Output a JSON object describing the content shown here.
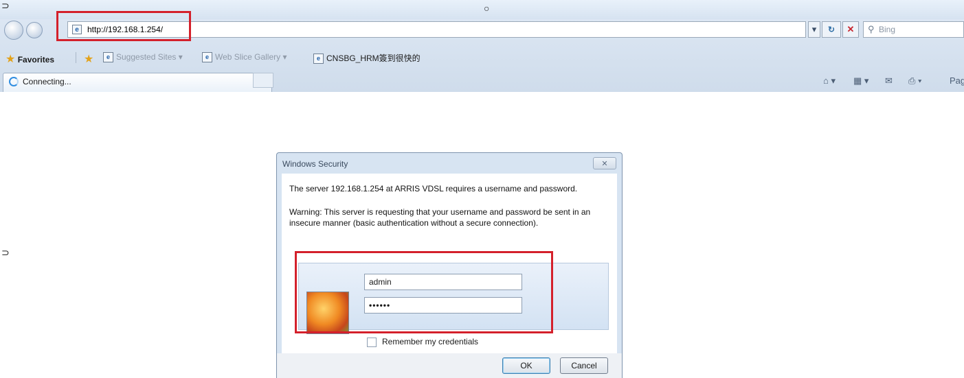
{
  "browser": {
    "address_url": "http://192.168.1.254/",
    "search_placeholder": "Bing",
    "favorites": {
      "label": "Favorites",
      "items": [
        "Suggested Sites ▾",
        "Web Slice Gallery ▾",
        "CNSBG_HRM簽到很快的"
      ]
    },
    "tab": {
      "label": "Connecting..."
    },
    "command_bar": "Pag"
  },
  "dialog": {
    "title": "Windows Security",
    "close_label": "✕",
    "message": "The server 192.168.1.254 at ARRIS VDSL requires a username and password.",
    "warning": "Warning: This server is requesting that your username and password be sent in an insecure manner (basic authentication without a secure connection).",
    "username": "admin",
    "password": "••••••",
    "remember_label": "Remember my credentials",
    "ok_label": "OK",
    "cancel_label": "Cancel"
  },
  "colors": {
    "highlight": "#d4202b",
    "chrome": "#d6e3f1"
  }
}
